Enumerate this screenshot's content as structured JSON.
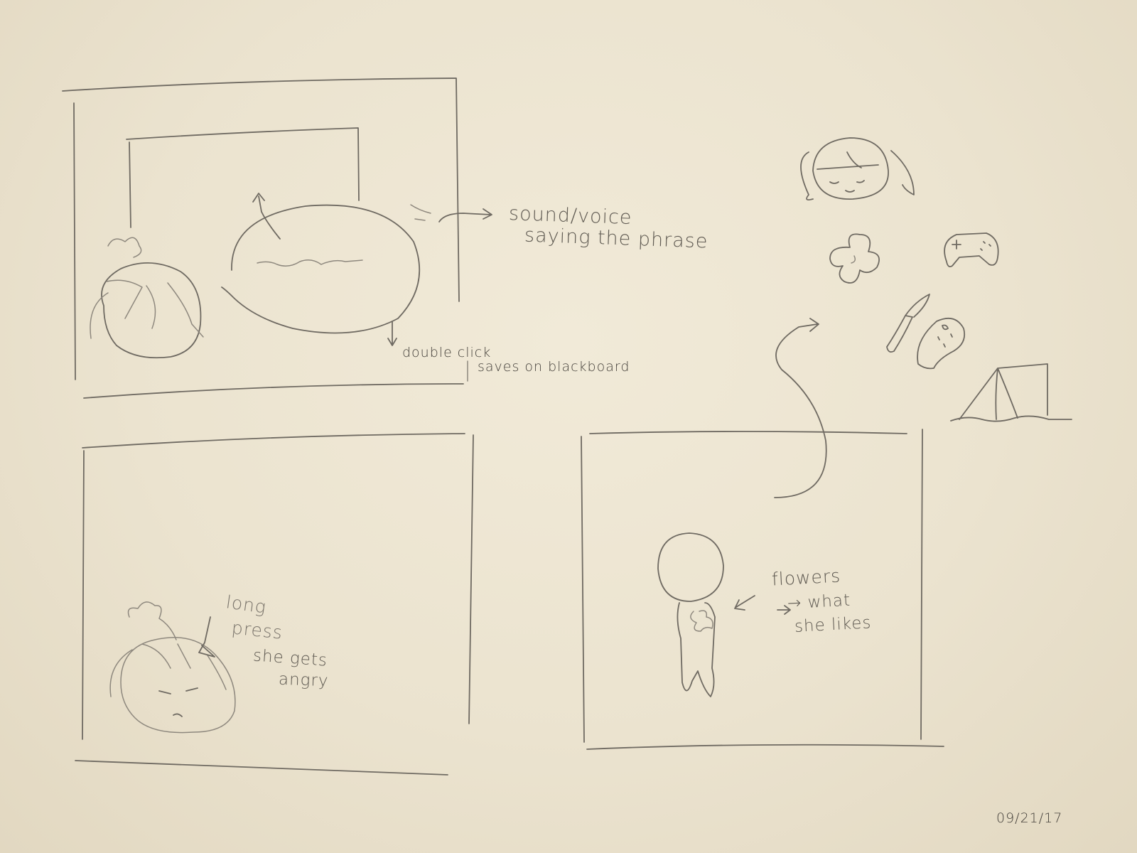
{
  "panel_1": {
    "note_sound": "sound/voice",
    "note_saying": "saying the phrase",
    "note_double_click": "double click",
    "note_saves": "saves on blackboard"
  },
  "panel_2": {
    "note_long": "long",
    "note_press": "press",
    "note_gets": "she gets",
    "note_angry": "angry"
  },
  "panel_3": {
    "note_flowers": "flowers",
    "note_what": "→ what",
    "note_likes": "she likes"
  },
  "preferences": {
    "icons": [
      "girl-face-icon",
      "flower-icon",
      "game-controller-icon",
      "paintbrush-icon",
      "paint-palette-icon",
      "tent-icon"
    ]
  },
  "date": "09/21/17",
  "colors": {
    "paper": "#ebe3cf",
    "pencil": "#6f6a62"
  }
}
